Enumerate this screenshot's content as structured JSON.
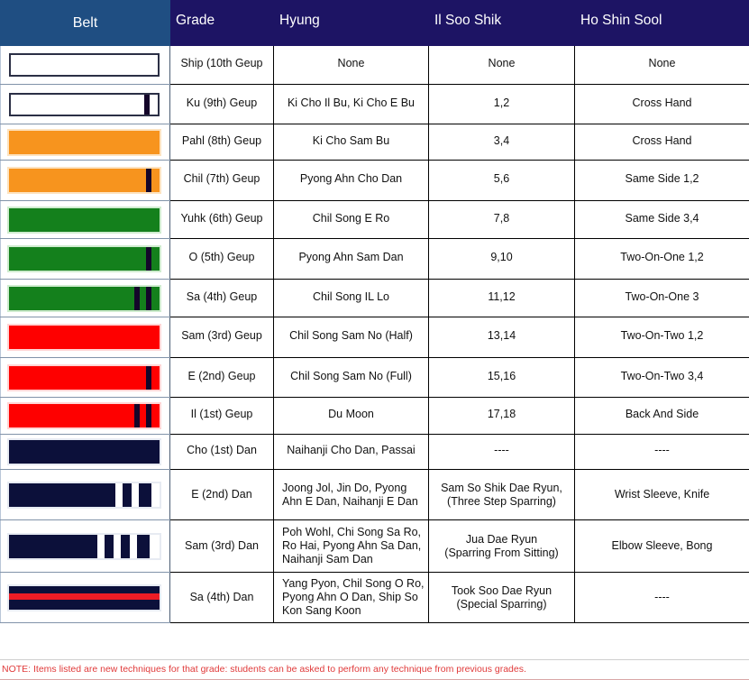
{
  "header": {
    "belt": "Belt",
    "grade": "Grade",
    "hyung": "Hyung",
    "il_soo_shik": "Il Soo Shik",
    "ho_shin_sool": "Ho Shin Sool"
  },
  "colors": {
    "header_belt_bg": "#1f4e82",
    "header_bg": "#1d1464",
    "note_text": "#e03a3a",
    "white_belt": "#ffffff",
    "orange_belt": "#f7941e",
    "green_belt": "#14801c",
    "red_belt": "#fe0000",
    "navy_belt": "#0c103a",
    "stripe_dark": "#14062a",
    "red_stripe": "#ee1c25"
  },
  "rows": [
    {
      "grade": "Ship (10th Geup",
      "hyung": "None",
      "il_soo_shik": "None",
      "ho_shin_sool": "None",
      "belt": {
        "color": "white",
        "style": "outlined",
        "stripes": 0
      }
    },
    {
      "grade": "Ku (9th) Geup",
      "hyung": "Ki Cho Il Bu, Ki Cho E Bu",
      "il_soo_shik": "1,2",
      "ho_shin_sool": "Cross Hand",
      "belt": {
        "color": "white",
        "style": "outlined",
        "stripes": 1
      }
    },
    {
      "grade": "Pahl (8th) Geup",
      "hyung": "Ki Cho Sam Bu",
      "il_soo_shik": "3,4",
      "ho_shin_sool": "Cross Hand",
      "belt": {
        "color": "orange",
        "style": "solid",
        "stripes": 0
      }
    },
    {
      "grade": "Chil (7th) Geup",
      "hyung": "Pyong Ahn Cho Dan",
      "il_soo_shik": "5,6",
      "ho_shin_sool": "Same Side 1,2",
      "belt": {
        "color": "orange",
        "style": "solid",
        "stripes": 1
      }
    },
    {
      "grade": "Yuhk (6th) Geup",
      "hyung": "Chil Song E Ro",
      "il_soo_shik": "7,8",
      "ho_shin_sool": "Same Side 3,4",
      "belt": {
        "color": "green",
        "style": "solid",
        "stripes": 0
      }
    },
    {
      "grade": "O (5th) Geup",
      "hyung": "Pyong Ahn Sam Dan",
      "il_soo_shik": "9,10",
      "ho_shin_sool": "Two-On-One 1,2",
      "belt": {
        "color": "green",
        "style": "solid",
        "stripes": 1
      }
    },
    {
      "grade": "Sa (4th) Geup",
      "hyung": "Chil Song IL Lo",
      "il_soo_shik": "11,12",
      "ho_shin_sool": "Two-On-One 3",
      "belt": {
        "color": "green",
        "style": "solid",
        "stripes": 2
      }
    },
    {
      "grade": "Sam (3rd) Geup",
      "hyung": "Chil Song Sam No (Half)",
      "il_soo_shik": "13,14",
      "ho_shin_sool": "Two-On-Two 1,2",
      "belt": {
        "color": "red",
        "style": "solid",
        "stripes": 0
      }
    },
    {
      "grade": "E (2nd) Geup",
      "hyung": "Chil Song Sam No (Full)",
      "il_soo_shik": "15,16",
      "ho_shin_sool": "Two-On-Two 3,4",
      "belt": {
        "color": "red",
        "style": "solid",
        "stripes": 1
      }
    },
    {
      "grade": "Il (1st) Geup",
      "hyung": "Du Moon",
      "il_soo_shik": "17,18",
      "ho_shin_sool": "Back And Side",
      "belt": {
        "color": "red",
        "style": "solid",
        "stripes": 2
      }
    },
    {
      "grade": "Cho (1st) Dan",
      "hyung": "Naihanji Cho Dan, Passai",
      "il_soo_shik": "----",
      "ho_shin_sool": "----",
      "belt": {
        "color": "navy",
        "style": "dan",
        "stripes": 0
      }
    },
    {
      "grade": "E (2nd) Dan",
      "hyung": "Joong Jol, Jin Do, Pyong\nAhn E Dan, Naihanji E Dan",
      "il_soo_shik": "Sam So Shik Dae Ryun,\n(Three Step Sparring)",
      "ho_shin_sool": "Wrist Sleeve, Knife",
      "belt": {
        "color": "navy",
        "style": "dan",
        "stripes": 2
      }
    },
    {
      "grade": "Sam (3rd) Dan",
      "hyung": "Poh Wohl, Chi Song Sa Ro,\nRo Hai, Pyong Ahn Sa Dan,\nNaihanji Sam Dan",
      "il_soo_shik": "Jua Dae Ryun\n(Sparring From Sitting)",
      "ho_shin_sool": "Elbow Sleeve, Bong",
      "belt": {
        "color": "navy",
        "style": "dan",
        "stripes": 3
      }
    },
    {
      "grade": "Sa (4th) Dan",
      "hyung": "Yang Pyon, Chil Song O Ro,\nPyong Ahn O Dan, Ship So\nKon Sang Koon",
      "il_soo_shik": "Took Soo Dae Ryun\n(Special Sparring)",
      "ho_shin_sool": "----",
      "belt": {
        "color": "navy",
        "style": "redstripe",
        "stripes": 0
      }
    }
  ],
  "note": "NOTE: Items listed are new techniques for that grade: students can be asked to perform any technique from previous grades."
}
